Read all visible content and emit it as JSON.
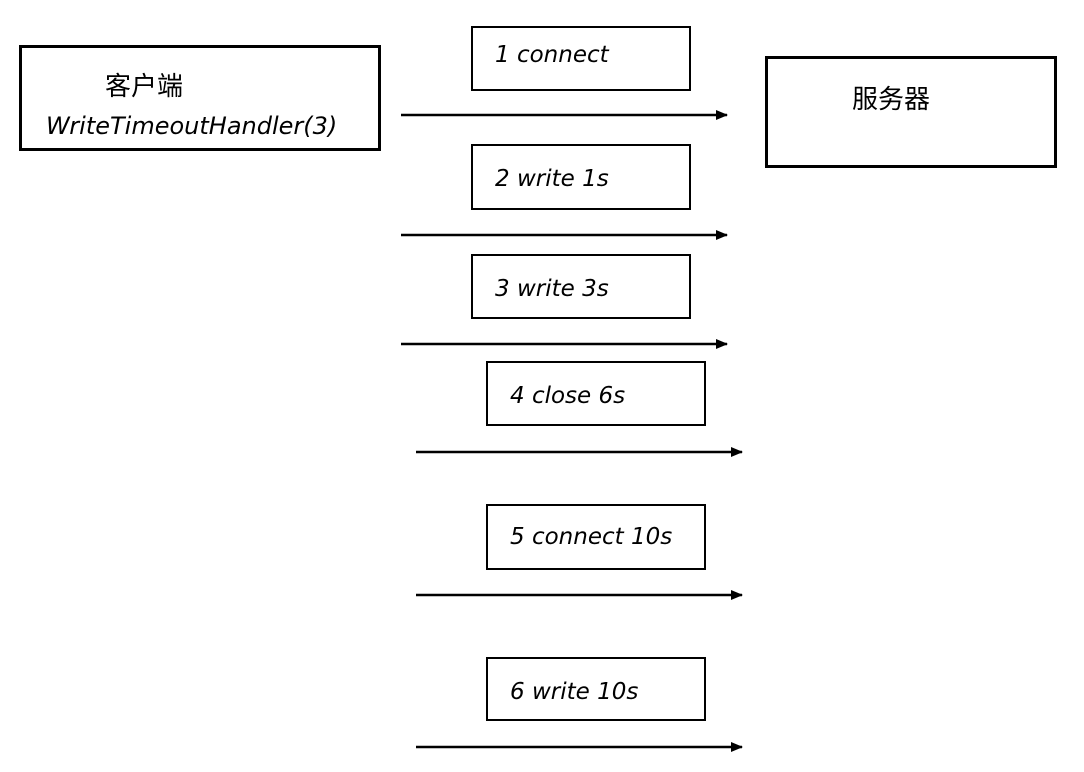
{
  "client": {
    "title": "客户端",
    "subtitle": "WriteTimeoutHandler(3)"
  },
  "server": {
    "title": "服务器"
  },
  "messages": [
    {
      "label": "1 connect"
    },
    {
      "label": "2 write 1s"
    },
    {
      "label": "3 write 3s"
    },
    {
      "label": "4 close 6s"
    },
    {
      "label": "5 connect 10s"
    },
    {
      "label": "6 write 10s"
    }
  ]
}
